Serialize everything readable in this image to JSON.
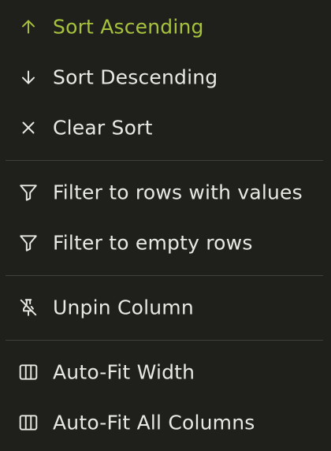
{
  "menu": {
    "items": [
      {
        "label": "Sort Ascending",
        "icon": "arrow-up-icon",
        "active": true
      },
      {
        "label": "Sort Descending",
        "icon": "arrow-down-icon"
      },
      {
        "label": "Clear Sort",
        "icon": "close-icon"
      },
      {
        "label": "Filter to rows with values",
        "icon": "filter-icon"
      },
      {
        "label": "Filter to empty rows",
        "icon": "filter-icon"
      },
      {
        "label": "Unpin Column",
        "icon": "pin-off-icon"
      },
      {
        "label": "Auto-Fit Width",
        "icon": "columns-icon"
      },
      {
        "label": "Auto-Fit All Columns",
        "icon": "columns-icon"
      }
    ]
  },
  "colors": {
    "background": "#1f201b",
    "text": "#e9e9e4",
    "accent": "#a6c23d",
    "divider": "#3f403a"
  }
}
